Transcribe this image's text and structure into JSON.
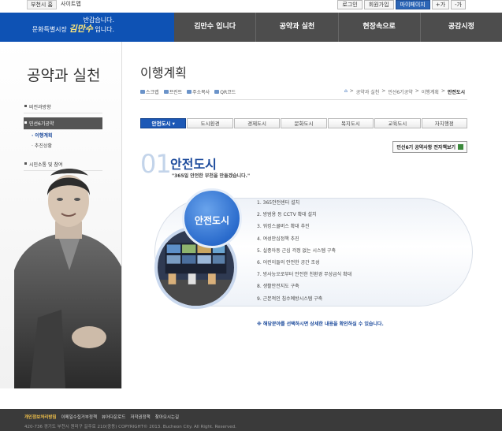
{
  "topbar": {
    "left": [
      "부천시 홈",
      "사이트맵"
    ],
    "right": [
      "로그인",
      "회원가입",
      "마이페이지",
      "+가",
      "-가"
    ]
  },
  "brand": {
    "greeting": "반갑습니다.",
    "line2_prefix": "문화특별시장",
    "line2_name": "김만수",
    "line2_suffix": "입니다."
  },
  "gnb": [
    "김만수 입니다",
    "공약과 실천",
    "현장속으로",
    "공감시정"
  ],
  "sidebar": {
    "title": "공약과 실천",
    "items": [
      {
        "label": "비전과방향"
      },
      {
        "label": "민선6기공약",
        "active": true
      },
      {
        "label": "이행계획",
        "sub": true,
        "current": true
      },
      {
        "label": "추진상황",
        "sub": true
      },
      {
        "label": "시민소통 및 참여"
      }
    ]
  },
  "main": {
    "title": "이행계획",
    "tools": [
      "스크랩",
      "프린트",
      "주소복사",
      "QR코드"
    ],
    "breadcrumb": [
      "공약과 실천",
      "민선6기공약",
      "이행계획",
      "안전도시"
    ],
    "tabs": [
      "안전도시",
      "도시환경",
      "경제도시",
      "문화도시",
      "복지도시",
      "교육도시",
      "자치행정"
    ],
    "ebook_button": "민선6기 공약사항 전자책보기",
    "section_number": "01",
    "section_title": "안전도시",
    "section_quote": "\"365일 안전한 부천을 만들겠습니다.\"",
    "badge": "안전도시",
    "plans": [
      "1. 365안전센터 설치",
      "2. 방범용 등 CCTV 확대 설치",
      "3. 워킹스쿨버스 확대 추진",
      "4. 여성안심정책 추진",
      "5. 실종아동 근심 걱정 없는 시스템 구축",
      "6. 어린이들의 안전한 공간 조성",
      "7. 방사능오로부터 안전한 친환경 무상급식 확대",
      "8. 생활안전지도 구축",
      "9. 근본적인 침수예방시스템 구축"
    ],
    "note": "※ 해당분야를 선택하시면 상세한 내용을 확인하실 수 있습니다."
  },
  "footer": {
    "links": [
      "개인정보처리방침",
      "이메일수집거부정책",
      "뷰어다운로드",
      "저작권정책",
      "찾아오시는길"
    ],
    "address": "420-736 경기도 부천시 원미구 길주로 210(중동) COPYRIGHT© 2013. Bucheon City. All Right. Reserved."
  },
  "colors": {
    "brand_blue": "#0e52b4",
    "gnb_gray": "#4d4d4d",
    "accent_blue": "#1d4b9c",
    "tab_active": "#1c58b6",
    "footer": "#3a3a3a"
  }
}
